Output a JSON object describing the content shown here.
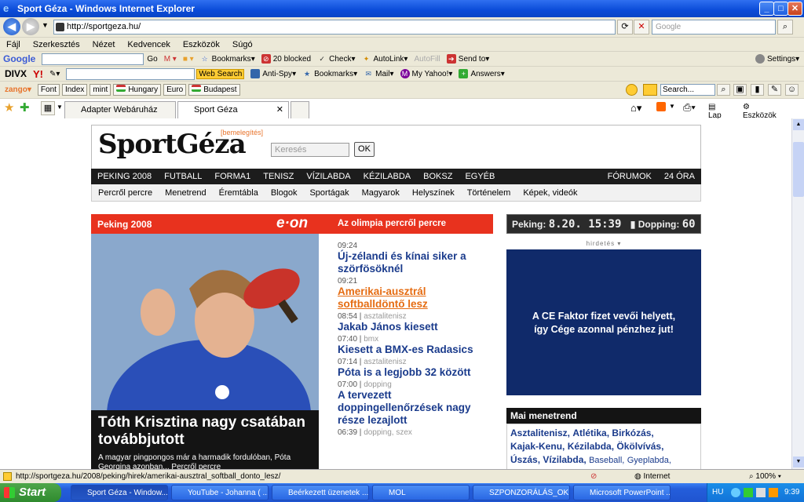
{
  "window": {
    "title": "Sport Géza - Windows Internet Explorer",
    "buttons": [
      "_",
      "□",
      "✕"
    ]
  },
  "address": {
    "url": "http://sportgeza.hu/",
    "search_placeholder": "Google"
  },
  "menu": [
    "Fájl",
    "Szerkesztés",
    "Nézet",
    "Kedvencek",
    "Eszközök",
    "Súgó"
  ],
  "google_bar": {
    "logo": "Google",
    "go": "Go",
    "items": [
      "Bookmarks",
      "20 blocked",
      "Check",
      "AutoLink",
      "AutoFill",
      "Send to"
    ],
    "settings": "Settings"
  },
  "yahoo_bar": {
    "divx": "DIVX",
    "yahoo": "Y!",
    "web_search": "Web Search",
    "items": [
      "Anti-Spy",
      "Bookmarks",
      "Mail",
      "My Yahoo!",
      "Answers"
    ]
  },
  "zango_bar": {
    "zango": "zango",
    "buttons": [
      "Font",
      "Index",
      "mint",
      "Hungary",
      "Euro",
      "Budapest"
    ],
    "search_placeholder": "Search..."
  },
  "tabs": [
    "Adapter Webáruház",
    "Sport Géza"
  ],
  "cmdbar": {
    "page": "Lap",
    "tools": "Eszközök"
  },
  "site": {
    "logo": "SportGéza",
    "ad_note": "[bemelegítés]",
    "search_placeholder": "Keresés",
    "ok": "OK",
    "nav1": [
      "PEKING 2008",
      "FUTBALL",
      "FORMA1",
      "TENISZ",
      "VÍZILABDA",
      "KÉZILABDA",
      "BOKSZ",
      "EGYÉB"
    ],
    "nav1_right": [
      "FÓRUMOK",
      "24 ÓRA"
    ],
    "nav2": [
      "Percről percre",
      "Menetrend",
      "Éremtábla",
      "Blogok",
      "Sportágak",
      "Magyarok",
      "Helyszínek",
      "Történelem",
      "Képek, videók"
    ],
    "red_left": "Peking 2008",
    "red_logo": "e·on",
    "red_right": "Az olimpia percről percre",
    "lead_title": "Tóth Krisztina nagy csatában továbbjutott",
    "lead_text": "A magyar pingpongos már a harmadik fordulóban, Póta Georgina azonban... Percről percre",
    "news": [
      {
        "time": "09:24",
        "cat": "",
        "title": "Új-zélandi és kínai siker a szörfösöknél"
      },
      {
        "time": "09:21",
        "cat": "",
        "title": "Amerikai-ausztrál softballdöntő lesz",
        "hover": true
      },
      {
        "time": "08:54",
        "cat": "asztalitenisz",
        "title": "Jakab János kiesett"
      },
      {
        "time": "07:40",
        "cat": "bmx",
        "title": "Kiesett a BMX-es Radasics"
      },
      {
        "time": "07:14",
        "cat": "asztalitenisz",
        "title": "Póta is a legjobb 32 között"
      },
      {
        "time": "07:00",
        "cat": "dopping",
        "title": "A tervezett doppingellenőrzések nagy része lezajlott"
      },
      {
        "time": "06:39",
        "cat": "dopping, szex",
        "title": ""
      }
    ],
    "clock": {
      "label1": "Peking:",
      "value1": "8.20. 15:39",
      "label2": "Dopping:",
      "value2": "60"
    },
    "hirdetes": "hirdetés",
    "ad_text": [
      "A CE Faktor fizet vevői helyett,",
      "így Cége azonnal pénzhez jut!"
    ],
    "menetrend_title": "Mai menetrend",
    "menetrend_bold": [
      "Asztalitenisz,",
      "Atlétika,",
      "Birkózás,",
      "Kajak-Kenu,",
      "Kézilabda,",
      "Ökölvívás,",
      "Úszás,",
      "Vízilabda,"
    ],
    "menetrend_normal": [
      "Baseball,",
      "Gyeplabda,"
    ]
  },
  "status": {
    "url": "http://sportgeza.hu/2008/peking/hirek/amerikai-ausztral_softball_donto_lesz/",
    "zone": "Internet",
    "zoom": "100%"
  },
  "taskbar": {
    "start": "Start",
    "tasks": [
      "Sport Géza - Window...",
      "YouTube - Johanna ( ...",
      "Beérkezett üzenetek ...",
      "MOL",
      "SZPONZORÁLÁS_OK",
      "Microsoft PowerPoint ..."
    ],
    "lang": "HU",
    "time": "9:39"
  },
  "colors": {
    "accent_red": "#e8321e",
    "link_blue": "#1a3b8c",
    "hover_orange": "#e56c12",
    "ad_blue": "#102a6a"
  }
}
